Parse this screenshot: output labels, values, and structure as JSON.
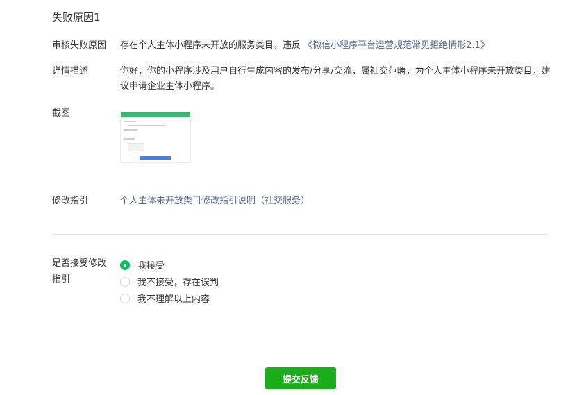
{
  "section_title": "失败原因1",
  "rows": {
    "reason_label": "审核失败原因",
    "reason_text": "存在个人主体小程序未开放的服务类目，违反",
    "reason_link": "《微信小程序平台运营规范常见拒绝情形2.1》",
    "detail_label": "详情描述",
    "detail_text": "你好，你的小程序涉及用户自行生成内容的发布/分享/交流，属社交范畴，为个人主体小程序未开放类目，建议申请企业主体小程序。",
    "screenshot_label": "截图",
    "guide_label": "修改指引",
    "guide_link": "个人主体未开放类目修改指引说明（社交服务）"
  },
  "question": {
    "label": "是否接受修改指引",
    "options": [
      {
        "label": "我接受",
        "selected": true
      },
      {
        "label": "我不接受，存在误判",
        "selected": false
      },
      {
        "label": "我不理解以上内容",
        "selected": false
      }
    ]
  },
  "submit_label": "提交反馈",
  "colors": {
    "link": "#576b95",
    "accent_green": "#07c160",
    "button_green": "#1aad19"
  }
}
